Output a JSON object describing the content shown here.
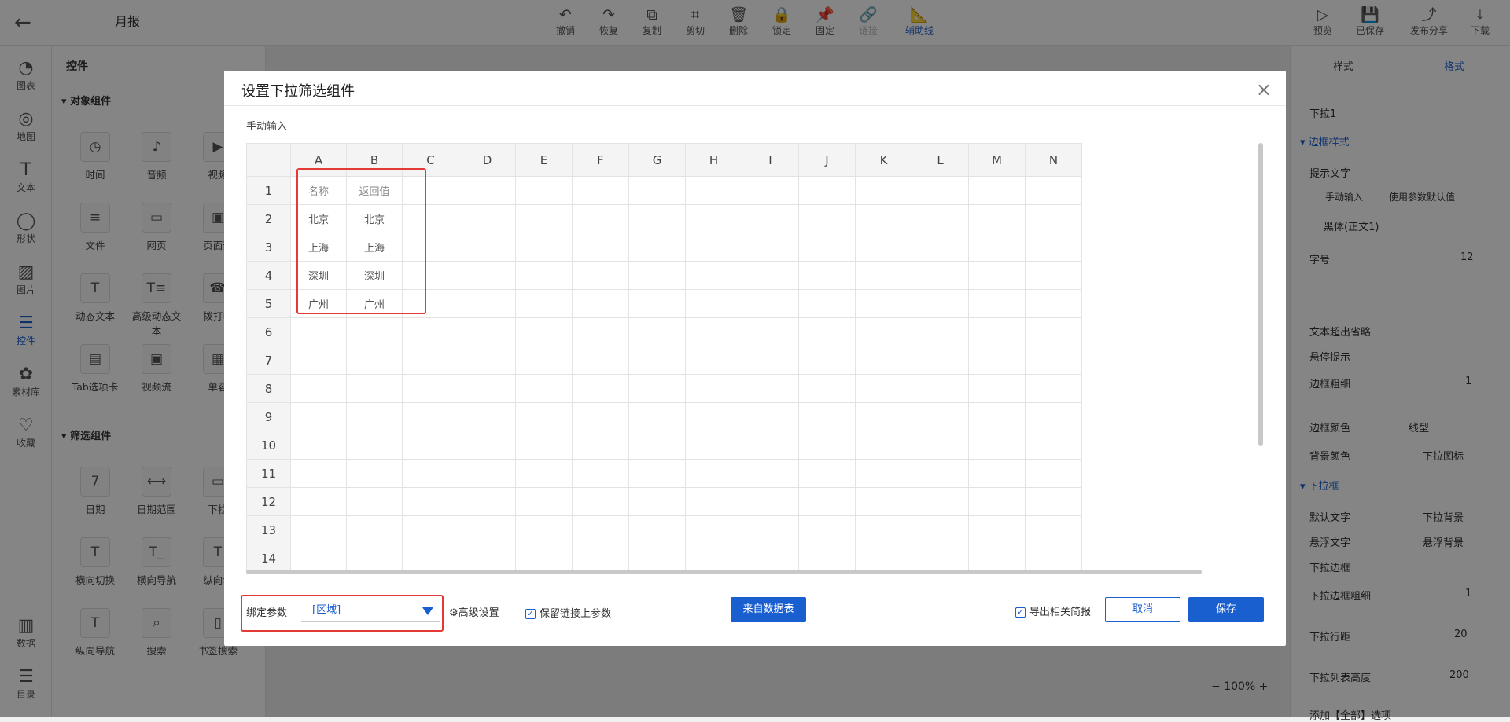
{
  "header": {
    "title": "月报",
    "tools": [
      "撤销",
      "恢复",
      "复制",
      "剪切",
      "删除",
      "锁定",
      "固定",
      "链接",
      "辅助线"
    ],
    "right_tools": [
      "预览",
      "已保存",
      "发布分享",
      "下载"
    ]
  },
  "left_nav": [
    "图表",
    "地图",
    "文本",
    "形状",
    "图片",
    "控件",
    "素材库",
    "收藏",
    "数据",
    "目录"
  ],
  "panel": {
    "title": "控件",
    "section1": "对象组件",
    "section2": "筛选组件",
    "items1": [
      "时间",
      "音频",
      "视频",
      "文件",
      "网页",
      "页面嵌",
      "动态文本",
      "高级动态文本",
      "拨打电",
      "Tab选项卡",
      "视频流",
      "单容"
    ],
    "items2": [
      "日期",
      "日期范围",
      "下拉",
      "横向切换",
      "横向导航",
      "纵向切",
      "纵向导航",
      "搜索",
      "书签搜索"
    ]
  },
  "right_panel": {
    "tab_style": "样式",
    "tab_format": "格式",
    "name": "下拉1",
    "border_section": "边框样式",
    "hint_text": "提示文字",
    "radio1": "手动输入",
    "radio2": "使用参数默认值",
    "font": "黑体(正文1)",
    "font_size_label": "字号",
    "font_size": "12",
    "overflow": "文本超出省略",
    "hover_tip": "悬停提示",
    "border_width_label": "边框粗细",
    "border_width": "1",
    "border_color": "边框颜色",
    "line_type": "线型",
    "bg_color": "背景颜色",
    "dropdown_icon": "下拉图标",
    "dropdown_section": "下拉框",
    "default_text": "默认文字",
    "dropdown_bg": "下拉背景",
    "hover_text": "悬浮文字",
    "hover_bg": "悬浮背景",
    "dropdown_border": "下拉边框",
    "dropdown_border_w_label": "下拉边框粗细",
    "dropdown_border_w": "1",
    "row_gap_label": "下拉行距",
    "row_gap": "20",
    "list_height_label": "下拉列表高度",
    "list_height": "200",
    "zoom": "100%",
    "add_all": "添加【全部】选项"
  },
  "dialog": {
    "title": "设置下拉筛选组件",
    "subtitle": "手动输入",
    "columns": [
      "A",
      "B",
      "C",
      "D",
      "E",
      "F",
      "G",
      "H",
      "I",
      "J",
      "K",
      "L",
      "M",
      "N"
    ],
    "rows": [
      [
        "名称",
        "返回值"
      ],
      [
        "北京",
        "北京"
      ],
      [
        "上海",
        "上海"
      ],
      [
        "深圳",
        "深圳"
      ],
      [
        "广州",
        "广州"
      ],
      [
        "",
        ""
      ],
      [
        "",
        ""
      ],
      [
        "",
        ""
      ],
      [
        "",
        ""
      ],
      [
        "",
        ""
      ],
      [
        "",
        ""
      ],
      [
        "",
        ""
      ],
      [
        "",
        ""
      ],
      [
        "",
        ""
      ]
    ],
    "bind_label": "绑定参数",
    "bind_value": "[区域]",
    "advanced": "高级设置",
    "keep_link": "保留链接上参数",
    "from_table": "来自数据表",
    "export_related": "导出相关简报",
    "cancel": "取消",
    "save": "保存"
  }
}
